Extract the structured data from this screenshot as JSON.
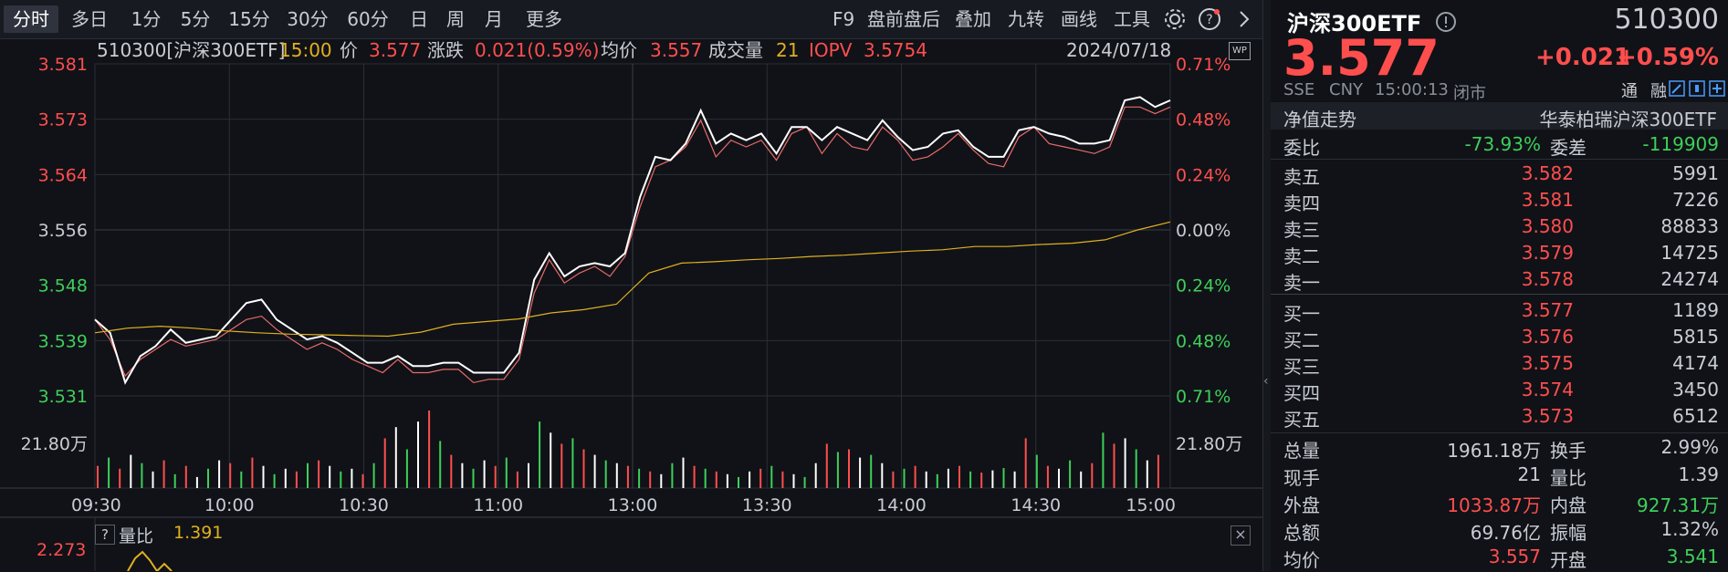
{
  "toolbar": {
    "tabs": [
      "分时",
      "多日",
      "1分",
      "5分",
      "15分",
      "30分",
      "60分",
      "日",
      "周",
      "月",
      "更多"
    ],
    "active_tab": "分时",
    "tools": [
      "F9",
      "盘前盘后",
      "叠加",
      "九转",
      "画线",
      "工具"
    ]
  },
  "info": {
    "code": "510300[沪深300ETF]",
    "time": "15:00",
    "price_label": "价",
    "price": "3.577",
    "change_label": "涨跌",
    "change": "0.021(0.59%)",
    "avg_label": "均价",
    "avg": "3.557",
    "vol_label": "成交量",
    "vol": "21",
    "iopv_label": "IOPV",
    "iopv": "3.5754",
    "date": "2024/07/18",
    "wp": "WP"
  },
  "chart_data": {
    "type": "line",
    "x_ticks": [
      "09:30",
      "10:00",
      "10:30",
      "11:00",
      "13:00",
      "13:30",
      "14:00",
      "14:30",
      "15:00"
    ],
    "y_left_ticks": [
      "3.581",
      "3.573",
      "3.564",
      "3.556",
      "3.548",
      "3.539",
      "3.531"
    ],
    "y_right_ticks": [
      "0.71%",
      "0.48%",
      "0.24%",
      "0.00%",
      "0.24%",
      "0.48%",
      "0.71%"
    ],
    "ylim": [
      3.531,
      3.581
    ],
    "volume_label": "21.80万",
    "series": [
      {
        "values": [
          3.5425,
          3.5405,
          3.533,
          3.537,
          3.5385,
          3.541,
          3.539,
          3.5395,
          3.54,
          3.5425,
          3.545,
          3.5455,
          3.5425,
          3.541,
          3.5395,
          3.54,
          3.539,
          3.5375,
          3.536,
          3.536,
          3.537,
          3.5355,
          3.5355,
          3.536,
          3.536,
          3.5345,
          3.5345,
          3.5345,
          3.5375,
          3.5485,
          3.5525,
          3.549,
          3.5505,
          3.551,
          3.5505,
          3.5525,
          3.561,
          3.567,
          3.5665,
          3.569,
          3.574,
          3.569,
          3.5705,
          3.5695,
          3.5705,
          3.5675,
          3.5715,
          3.5715,
          3.5695,
          3.5715,
          3.5705,
          3.5695,
          3.5725,
          3.57,
          3.568,
          3.5685,
          3.5705,
          3.571,
          3.5685,
          3.567,
          3.567,
          3.571,
          3.5715,
          3.5705,
          3.57,
          3.569,
          3.569,
          3.5695,
          3.5755,
          3.576,
          3.5745,
          3.5755
        ]
      },
      {
        "values": [
          3.5425,
          3.5395,
          3.534,
          3.5365,
          3.538,
          3.5395,
          3.5385,
          3.539,
          3.5395,
          3.541,
          3.5425,
          3.543,
          3.541,
          3.5395,
          3.538,
          3.539,
          3.538,
          3.5365,
          3.5355,
          3.5345,
          3.5365,
          3.5345,
          3.5345,
          3.535,
          3.535,
          3.533,
          3.5335,
          3.5335,
          3.5365,
          3.5465,
          3.5515,
          3.548,
          3.5495,
          3.5505,
          3.549,
          3.552,
          3.5595,
          3.5655,
          3.5665,
          3.5685,
          3.5725,
          3.567,
          3.5695,
          3.5685,
          3.5695,
          3.5665,
          3.5705,
          3.5715,
          3.5675,
          3.5705,
          3.5685,
          3.568,
          3.5715,
          3.5695,
          3.5665,
          3.567,
          3.5685,
          3.5705,
          3.568,
          3.566,
          3.5655,
          3.57,
          3.5715,
          3.569,
          3.5685,
          3.568,
          3.5675,
          3.5685,
          3.5745,
          3.5745,
          3.5735,
          3.5745
        ]
      },
      {
        "values": [
          3.5405,
          3.5412,
          3.5415,
          3.5412,
          3.5408,
          3.5405,
          3.5403,
          3.5402,
          3.5401,
          3.54,
          3.5406,
          3.5418,
          3.5422,
          3.5426,
          3.5435,
          3.544,
          3.5448,
          3.5495,
          3.551,
          3.5512,
          3.5515,
          3.5517,
          3.552,
          3.5522,
          3.5525,
          3.5528,
          3.553,
          3.5535,
          3.5535,
          3.5538,
          3.554,
          3.5545,
          3.556,
          3.5572
        ]
      }
    ],
    "volume": [
      40,
      55,
      35,
      60,
      45,
      30,
      50,
      25,
      40,
      20,
      35,
      50,
      45,
      30,
      55,
      40,
      25,
      35,
      30,
      45,
      50,
      40,
      30,
      35,
      25,
      45,
      90,
      110,
      70,
      120,
      140,
      85,
      60,
      45,
      35,
      50,
      40,
      55,
      30,
      45,
      120,
      100,
      80,
      90,
      70,
      60,
      50,
      45,
      40,
      35,
      30,
      25,
      45,
      55,
      40,
      35,
      30,
      25,
      20,
      30,
      35,
      40,
      30,
      25,
      20,
      45,
      80,
      65,
      70,
      55,
      60,
      45,
      30,
      35,
      40,
      30,
      25,
      35,
      40,
      30,
      28,
      32,
      36,
      30,
      90,
      60,
      40,
      35,
      50,
      30,
      45,
      100,
      80,
      90,
      70,
      50,
      60
    ]
  },
  "sub": {
    "q": "?",
    "label": "量比",
    "value": "1.391",
    "axis_tick": "2.273"
  },
  "quote": {
    "name": "沪深300ETF",
    "code": "510300",
    "price": "3.577",
    "change": "+0.021",
    "change_pct": "+0.59%",
    "exchange": "SSE",
    "currency": "CNY",
    "time": "15:00:13",
    "status": "闭市",
    "tag_tong": "通",
    "tag_rong": "融",
    "nav_label": "净值走势",
    "fund_name": "华泰柏瑞沪深300ETF",
    "weibi_label": "委比",
    "weibi": "-73.93%",
    "weicha_label": "委差",
    "weicha": "-119909",
    "asks": [
      {
        "label": "卖五",
        "price": "3.582",
        "vol": "5991"
      },
      {
        "label": "卖四",
        "price": "3.581",
        "vol": "7226"
      },
      {
        "label": "卖三",
        "price": "3.580",
        "vol": "88833"
      },
      {
        "label": "卖二",
        "price": "3.579",
        "vol": "14725"
      },
      {
        "label": "卖一",
        "price": "3.578",
        "vol": "24274"
      }
    ],
    "bids": [
      {
        "label": "买一",
        "price": "3.577",
        "vol": "1189"
      },
      {
        "label": "买二",
        "price": "3.576",
        "vol": "5815"
      },
      {
        "label": "买三",
        "price": "3.575",
        "vol": "4174"
      },
      {
        "label": "买四",
        "price": "3.574",
        "vol": "3450"
      },
      {
        "label": "买五",
        "price": "3.573",
        "vol": "6512"
      }
    ],
    "stats": [
      {
        "l1": "总量",
        "v1": "1961.18万",
        "c1": "lbl",
        "l2": "换手",
        "v2": "2.99%",
        "c2": "lbl"
      },
      {
        "l1": "现手",
        "v1": "21",
        "c1": "lbl",
        "l2": "量比",
        "v2": "1.39",
        "c2": "lbl"
      },
      {
        "l1": "外盘",
        "v1": "1033.87万",
        "c1": "red",
        "l2": "内盘",
        "v2": "927.31万",
        "c2": "green"
      },
      {
        "l1": "总额",
        "v1": "69.76亿",
        "c1": "lbl",
        "l2": "振幅",
        "v2": "1.32%",
        "c2": "lbl"
      },
      {
        "l1": "均价",
        "v1": "3.557",
        "c1": "red",
        "l2": "开盘",
        "v2": "3.541",
        "c2": "green"
      }
    ]
  },
  "colors": {
    "up": "#ff4e4e",
    "down": "#3ecf5a",
    "avg": "#e0b020",
    "grid": "#2a2e36",
    "price": "#ffffff",
    "iopv": "#e86a6a"
  }
}
